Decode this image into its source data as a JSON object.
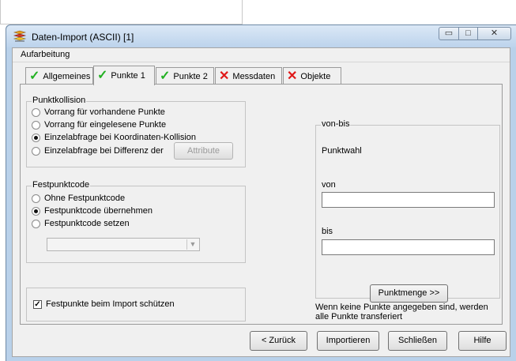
{
  "window": {
    "title": "Daten-Import (ASCII) [1]",
    "app_icon": "import-app-icon",
    "controls": {
      "minimize": "▭",
      "maximize": "□",
      "close": "✕"
    }
  },
  "menu": {
    "items": [
      "Aufarbeitung"
    ]
  },
  "tabs": [
    {
      "label": "Allgemeines",
      "status": "ok",
      "icon": "✓"
    },
    {
      "label": "Punkte 1",
      "status": "ok",
      "icon": "✓",
      "active": true
    },
    {
      "label": "Punkte 2",
      "status": "ok",
      "icon": "✓"
    },
    {
      "label": "Messdaten",
      "status": "error",
      "icon": "✕"
    },
    {
      "label": "Objekte",
      "status": "error",
      "icon": "✕"
    }
  ],
  "punktkollision": {
    "title": "Punktkollision",
    "options": [
      {
        "label": "Vorrang für vorhandene Punkte",
        "selected": false
      },
      {
        "label": "Vorrang für eingelesene Punkte",
        "selected": false
      },
      {
        "label": "Einzelabfrage bei Koordinaten-Kollision",
        "selected": true
      },
      {
        "label": "Einzelabfrage bei Differenz der",
        "selected": false
      }
    ],
    "attribute_button": "Attribute"
  },
  "festpunktcode": {
    "title": "Festpunktcode",
    "options": [
      {
        "label": "Ohne Festpunktcode",
        "selected": false
      },
      {
        "label": "Festpunktcode übernehmen",
        "selected": true
      },
      {
        "label": "Festpunktcode setzen",
        "selected": false
      }
    ],
    "combo_value": "",
    "combo_arrow": "▼"
  },
  "schutz": {
    "label": "Festpunkte beim Import schützen",
    "checked": true,
    "mark": "✓"
  },
  "vonbis": {
    "title": "von-bis",
    "punktwahl": "Punktwahl",
    "von_label": "von",
    "von_value": "",
    "bis_label": "bis",
    "bis_value": "",
    "punktmenge_button": "Punktmenge >>",
    "note": "Wenn keine Punkte angegeben sind, werden alle Punkte transferiert"
  },
  "buttons": {
    "back": "< Zurück",
    "import": "Importieren",
    "close": "Schließen",
    "help": "Hilfe"
  },
  "colors": {
    "check": "#22b022",
    "cross": "#e01818",
    "titlebar": "#bcd3ec"
  }
}
